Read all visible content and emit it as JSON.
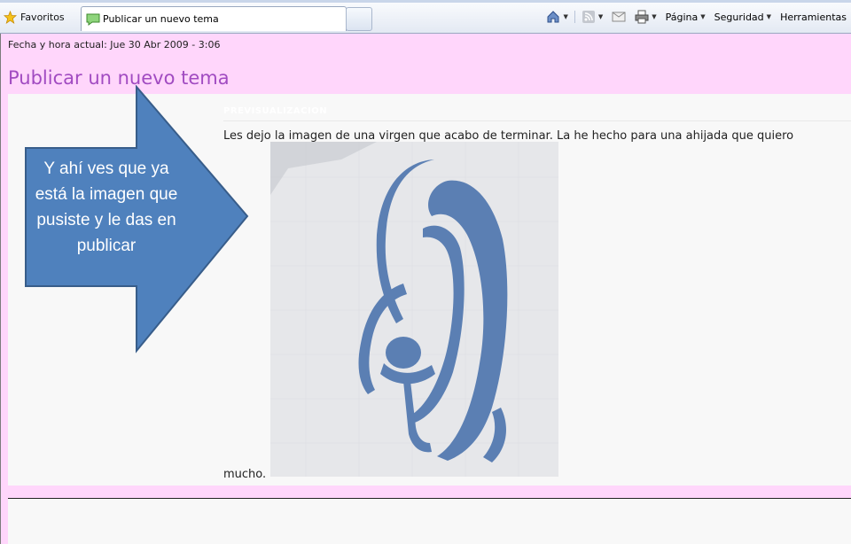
{
  "browser": {
    "favorites_label": "Favoritos",
    "tab_title": "Publicar un nuevo tema",
    "commands": {
      "page": "Página",
      "security": "Seguridad",
      "tools": "Herramientas"
    }
  },
  "page": {
    "datetime": "Fecha y hora actual: Jue 30 Abr 2009 - 3:06",
    "title": "Publicar un nuevo tema",
    "preview_header": "PREVISUALIZACION",
    "post_text": "Les dejo la imagen de una virgen que acabo de terminar. La he hecho para una ahijada que quiero",
    "post_text_end": "mucho."
  },
  "annotation": {
    "text": "Y ahí ves que ya está la imagen que pusiste y le das en publicar",
    "fill": "#4f81bd",
    "stroke": "#385d8a"
  },
  "colors": {
    "page_bg": "#ffd6fb",
    "title": "#a14bc1",
    "stitch": "#5b7fb3"
  }
}
